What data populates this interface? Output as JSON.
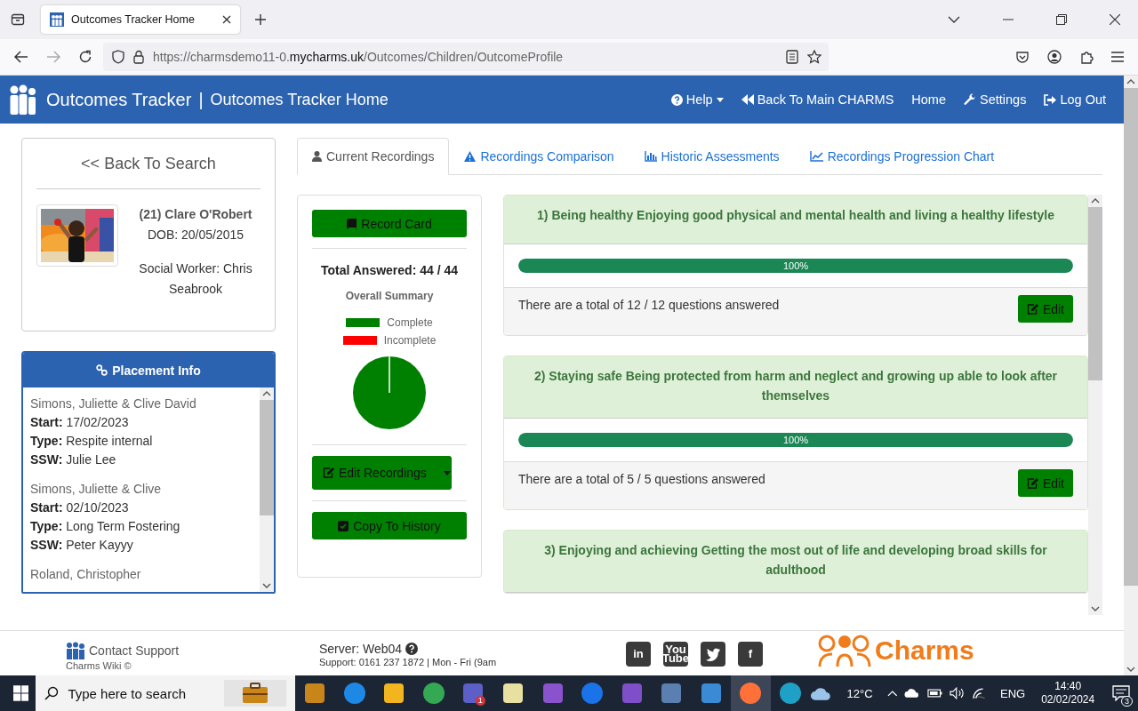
{
  "browser": {
    "tab_title": "Outcomes Tracker Home",
    "url": {
      "prefix": "https://charmsdemo11-0.",
      "domain": "mycharms.uk",
      "path": "/Outcomes/Children/OutcomeProfile"
    }
  },
  "navbar": {
    "brand": "Outcomes Tracker",
    "separator": "|",
    "page": "Outcomes Tracker Home",
    "items": [
      {
        "kind": "help",
        "label": "Help",
        "dropdown": true
      },
      {
        "kind": "back",
        "label": "Back To Main CHARMS",
        "dropdown": false
      },
      {
        "kind": "plain",
        "label": "Home",
        "dropdown": false
      },
      {
        "kind": "wrench",
        "label": "Settings",
        "dropdown": false
      },
      {
        "kind": "logout",
        "label": "Log Out",
        "dropdown": false
      }
    ]
  },
  "profile": {
    "back_link": "<< Back To Search",
    "name": "(21) Clare O'Robert",
    "dob": "DOB: 20/05/2015",
    "social_worker": "Social Worker: Chris Seabrook"
  },
  "placement": {
    "title": "Placement Info",
    "entries": [
      {
        "carer": "Simons, Juliette & Clive David",
        "fields": [
          {
            "label": "Start:",
            "value": "17/02/2023"
          },
          {
            "label": "Type:",
            "value": "Respite internal"
          },
          {
            "label": "SSW:",
            "value": "Julie Lee"
          }
        ]
      },
      {
        "carer": "Simons, Juliette & Clive",
        "fields": [
          {
            "label": "Start:",
            "value": "02/10/2023"
          },
          {
            "label": "Type:",
            "value": "Long Term Fostering"
          },
          {
            "label": "SSW:",
            "value": "Peter Kayyy"
          }
        ]
      },
      {
        "carer": "Roland, Christopher"
      }
    ]
  },
  "tabs": [
    {
      "kind": "user",
      "label": "Current Recordings",
      "selected": true
    },
    {
      "kind": "warning",
      "label": "Recordings Comparison",
      "selected": false
    },
    {
      "kind": "bars",
      "label": "Historic Assessments",
      "selected": false
    },
    {
      "kind": "line",
      "label": "Recordings Progression Chart",
      "selected": false
    }
  ],
  "summary": {
    "record_card": "Record Card",
    "total": "Total Answered: 44 / 44",
    "chart_title": "Overall Summary",
    "legend": [
      {
        "label": "Complete",
        "color": "#008000"
      },
      {
        "label": "Incomplete",
        "color": "#ff0000"
      }
    ],
    "edit_recordings": "Edit Recordings",
    "copy_to_history": "Copy To History"
  },
  "outcomes": [
    {
      "title": "1) Being healthy Enjoying good physical and mental health and living a healthy lifestyle",
      "level": 1,
      "percent": "100%",
      "summary": "There are a total of 12 / 12 questions answered",
      "edit": "Edit"
    },
    {
      "title": "2) Staying safe Being protected from harm and neglect and growing up able to look after themselves",
      "level": 1,
      "percent": "100%",
      "summary": "There are a total of 5 / 5 questions answered",
      "edit": "Edit"
    },
    {
      "title": "3) Enjoying and achieving Getting the most out of life and developing broad skills for adulthood"
    }
  ],
  "footer": {
    "contact": "Contact Support",
    "wiki": "Charms Wiki ©",
    "server": "Server: Web04",
    "support": "Support: 0161 237 1872 | Mon - Fri (9am",
    "social": [
      {
        "kind": "text",
        "label": "in"
      },
      {
        "kind": "text",
        "label": "You Tube"
      },
      {
        "kind": "bird"
      },
      {
        "kind": "text",
        "label": "f"
      }
    ],
    "logo": "Charms"
  },
  "taskbar": {
    "search_placeholder": "Type here to search",
    "apps": [
      {
        "kind": "tile",
        "color": "#c8861a",
        "selected": false
      },
      {
        "kind": "round",
        "color": "#1e88e5",
        "selected": false
      },
      {
        "kind": "tile",
        "color": "#f2b520",
        "selected": false
      },
      {
        "kind": "round",
        "color": "#34a853",
        "selected": false
      },
      {
        "kind": "tile",
        "color": "#5b5fc7",
        "selected": false,
        "badge": "1"
      },
      {
        "kind": "tile",
        "color": "#e8e0a0",
        "selected": false
      },
      {
        "kind": "tile",
        "color": "#8a52cc",
        "selected": false
      },
      {
        "kind": "round",
        "color": "#1a73e8",
        "selected": false
      },
      {
        "kind": "tile",
        "color": "#7f4fc9",
        "selected": false
      },
      {
        "kind": "tile",
        "color": "#5a7fb0",
        "selected": false
      },
      {
        "kind": "tile",
        "color": "#3a8ad6",
        "selected": false
      },
      {
        "kind": "round",
        "color": "#ff7139",
        "selected": true
      },
      {
        "kind": "round",
        "color": "#1fa0c6",
        "selected": false
      }
    ],
    "weather": "12°C",
    "language": "ENG",
    "time": "14:40",
    "date": "02/02/2024",
    "notifications": "3"
  }
}
